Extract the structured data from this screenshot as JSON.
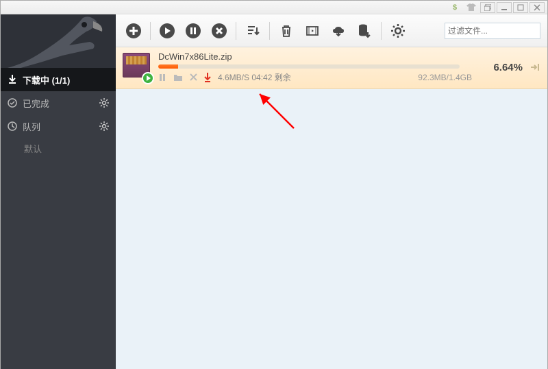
{
  "titlebar": {
    "dollar": "$"
  },
  "sidebar": {
    "items": [
      {
        "label": "下载中 (1/1)"
      },
      {
        "label": "已完成"
      },
      {
        "label": "队列"
      }
    ],
    "subitem": "默认"
  },
  "toolbar": {
    "search_placeholder": "过滤文件..."
  },
  "download": {
    "filename": "DcWin7x86Lite.zip",
    "speed": "4.6MB/S 04:42 剩余",
    "size": "92.3MB/1.4GB",
    "percent": "6.64%",
    "progress_pct": 6.64
  }
}
